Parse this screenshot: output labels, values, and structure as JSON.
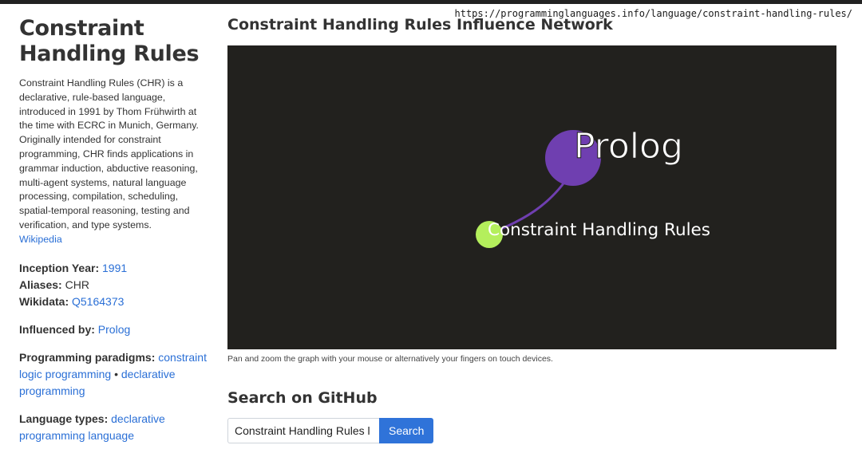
{
  "browser": {
    "url": "https://programminglanguages.info/language/constraint-handling-rules/"
  },
  "sidebar": {
    "title_line1": "Constraint",
    "title_line2": "Handling Rules",
    "description": "Constraint Handling Rules (CHR) is a declarative, rule-based language, introduced in 1991 by Thom Frühwirth at the time with ECRC in Munich, Germany. Originally intended for constraint programming, CHR finds applications in grammar induction, abductive reasoning, multi-agent systems, natural language processing, compilation, scheduling, spatial-temporal reasoning, testing and verification, and type systems.",
    "wikipedia_link": "Wikipedia",
    "inception_label": "Inception Year:",
    "inception_value": "1991",
    "aliases_label": "Aliases:",
    "aliases_value": "CHR",
    "wikidata_label": "Wikidata:",
    "wikidata_value": "Q5164373",
    "influenced_by_label": "Influenced by:",
    "influenced_by_value": "Prolog",
    "paradigms_label": "Programming paradigms:",
    "paradigms": [
      "constraint logic programming",
      "declarative programming"
    ],
    "paradigm_separator": "•",
    "types_label": "Language types:",
    "types_value": "declarative programming language"
  },
  "main": {
    "network_title": "Constraint Handling Rules Influence Network",
    "graph": {
      "nodes": [
        {
          "label": "Prolog",
          "color": "#6f3fb0"
        },
        {
          "label": "Constraint Handling Rules",
          "color": "#b4ef5c"
        }
      ],
      "edge_color": "#6f3fb0",
      "background": "#22211e"
    },
    "graph_caption": "Pan and zoom the graph with your mouse or alternatively your fingers on touch devices.",
    "github_title": "Search on GitHub",
    "search_value": "Constraint Handling Rules l",
    "search_button": "Search"
  },
  "colors": {
    "link": "#2a6fd6",
    "button": "#2f73d9"
  }
}
